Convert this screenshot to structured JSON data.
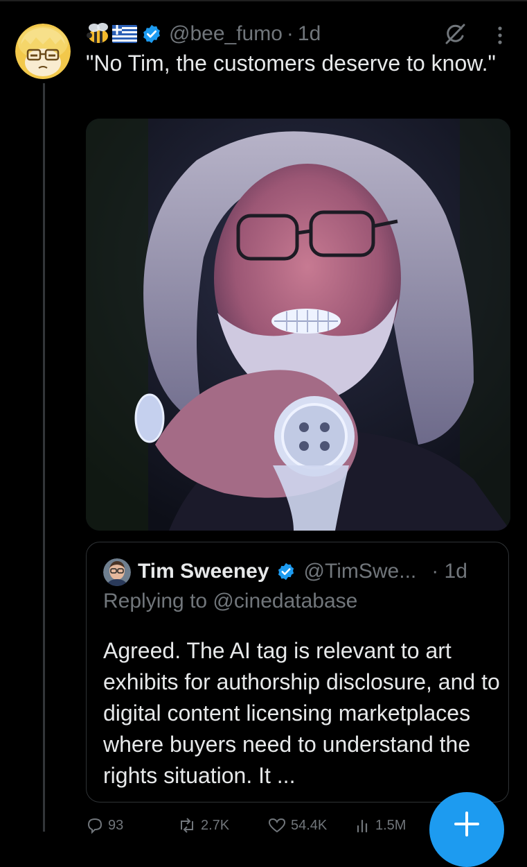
{
  "post": {
    "author_emoji": "🐝🇬🇷",
    "handle": "@bee_fumo",
    "separator": "·",
    "time": "1d",
    "text": "\"No Tim, the customers deserve to know.\""
  },
  "quote": {
    "name": "Tim Sweeney",
    "handle": "@TimSwe...",
    "time": "· 1d",
    "replying_to": "Replying to @cinedatabase",
    "text": "Agreed. The AI tag is relevant to art exhibits for authorship disclosure, and to digital content licensing marketplaces where buyers need to understand the rights situation. It ..."
  },
  "actions": {
    "replies": "93",
    "reposts": "2.7K",
    "likes": "54.4K",
    "views": "1.5M"
  },
  "icons": {
    "verified": "verified-badge-icon",
    "grok": "grok-icon",
    "more": "more-icon",
    "reply": "reply-icon",
    "repost": "repost-icon",
    "like": "like-icon",
    "views": "views-icon",
    "compose": "plus-icon"
  },
  "colors": {
    "background": "#000000",
    "text": "#e7e9ea",
    "secondary": "#71767b",
    "accent": "#1d9bf0",
    "border": "#2f3336"
  }
}
